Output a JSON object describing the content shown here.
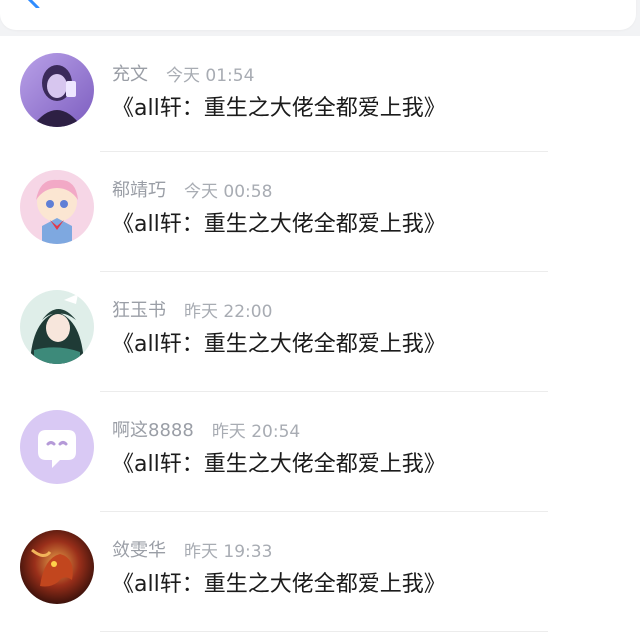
{
  "header": {
    "back_icon": "chevron-left-icon",
    "accent_color": "#2f8cff"
  },
  "comments": [
    {
      "user": "充文",
      "time": "今天 01:54",
      "text": "《all轩：重生之大佬全都爱上我》",
      "avatar": "purple-portrait-avatar"
    },
    {
      "user": "郗靖巧",
      "time": "今天 00:58",
      "text": "《all轩：重生之大佬全都爱上我》",
      "avatar": "anime-sailor-avatar"
    },
    {
      "user": "狂玉书",
      "time": "昨天 22:00",
      "text": "《all轩：重生之大佬全都爱上我》",
      "avatar": "ancient-style-avatar"
    },
    {
      "user": "啊这8888",
      "time": "昨天 20:54",
      "text": "《all轩：重生之大佬全都爱上我》",
      "avatar": "default-chat-avatar"
    },
    {
      "user": "敛雯华",
      "time": "昨天 19:33",
      "text": "《all轩：重生之大佬全都爱上我》",
      "avatar": "red-dragon-avatar"
    }
  ]
}
